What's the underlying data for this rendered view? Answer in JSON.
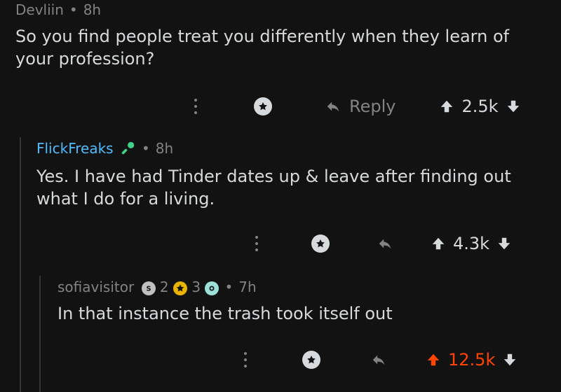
{
  "comments": [
    {
      "author": "Devliin",
      "time": "8h",
      "body": "So you find people treat you differently when they learn of your profession?",
      "reply_label": "Reply",
      "score": "2.5k",
      "upvoted": false
    },
    {
      "author": "FlickFreaks",
      "flair_icon": "microphone-icon",
      "time": "8h",
      "body": "Yes. I have had Tinder dates up & leave after finding out what I do for a living.",
      "score": "4.3k",
      "upvoted": false
    },
    {
      "author": "sofiavisitor",
      "badges": [
        {
          "icon": "silver-badge-icon",
          "count": "2"
        },
        {
          "icon": "gold-badge-icon",
          "count": "3"
        },
        {
          "icon": "cake-badge-icon",
          "count": ""
        }
      ],
      "time": "7h",
      "body": "In that instance the trash took itself out",
      "score": "12.5k",
      "upvoted": true
    }
  ],
  "colors": {
    "background": "#121212",
    "text": "#d7dadc",
    "meta": "#818384",
    "username_link": "#4fbcff",
    "upvote_active": "#ff4500"
  }
}
